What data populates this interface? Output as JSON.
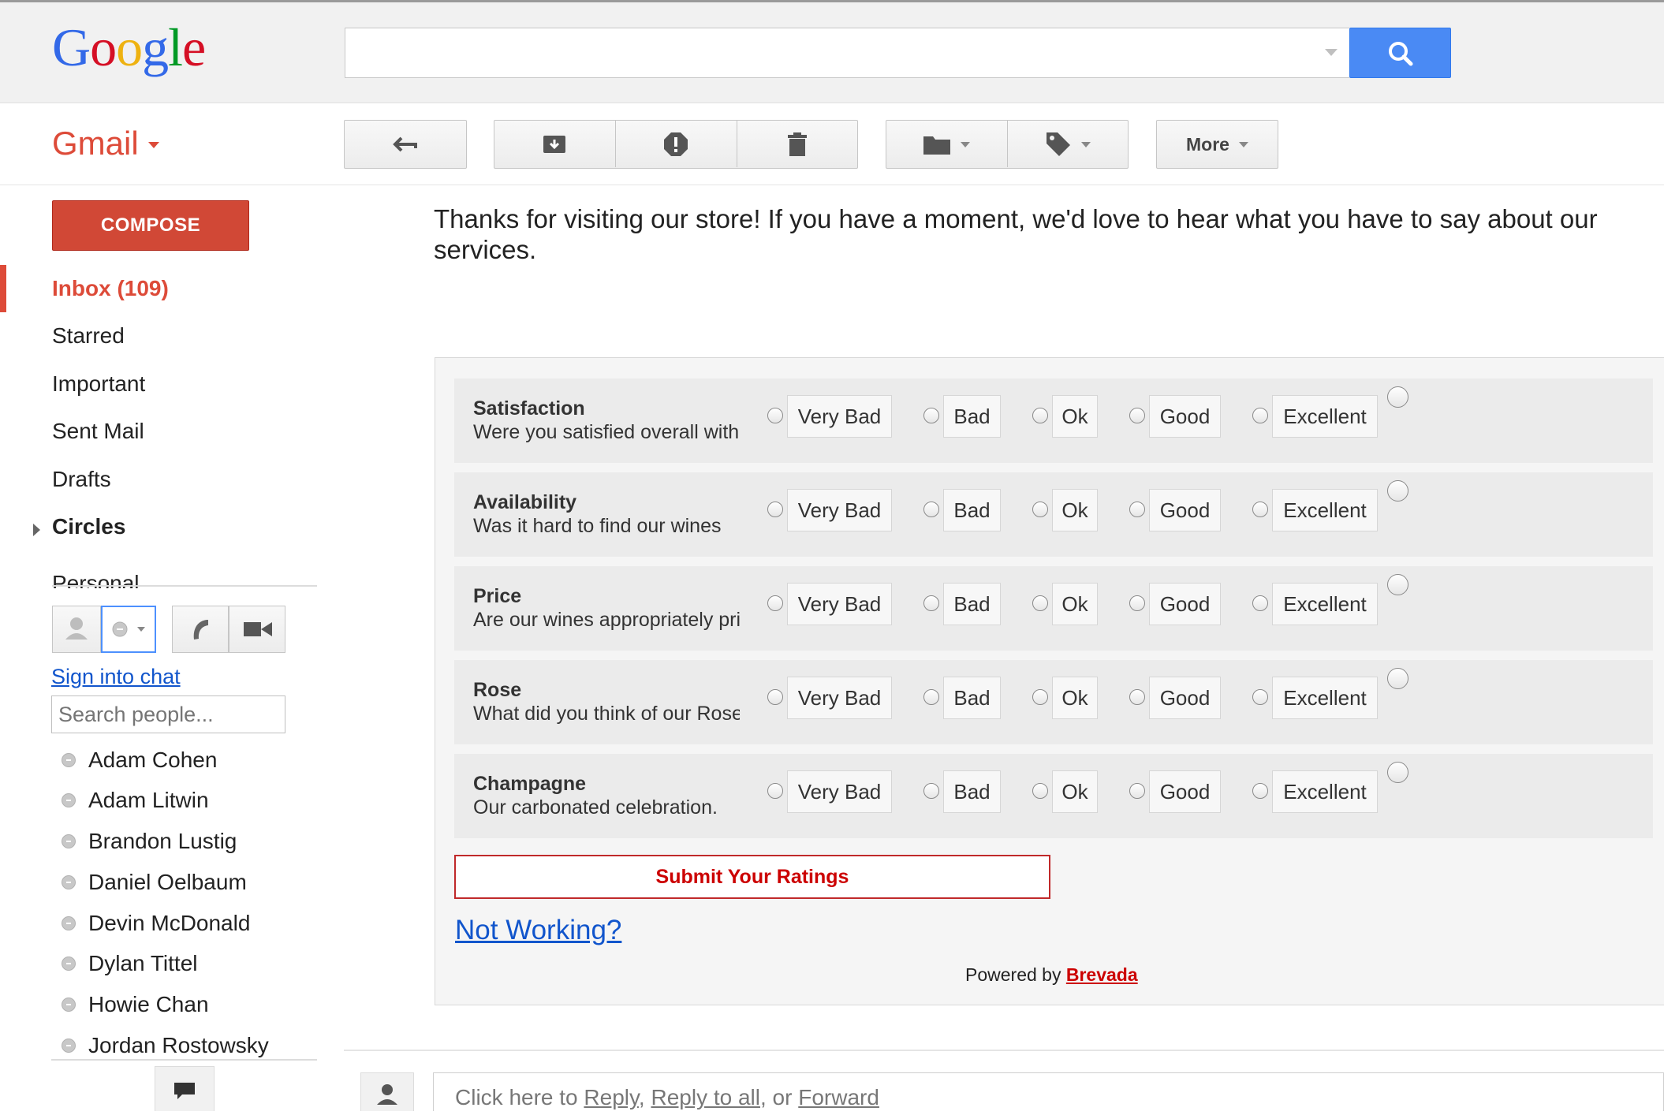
{
  "header": {
    "logo_letters": [
      {
        "ch": "G",
        "color": "#3369e8"
      },
      {
        "ch": "o",
        "color": "#d50f25"
      },
      {
        "ch": "o",
        "color": "#eeb211"
      },
      {
        "ch": "g",
        "color": "#3369e8"
      },
      {
        "ch": "l",
        "color": "#009925"
      },
      {
        "ch": "e",
        "color": "#d50f25"
      }
    ],
    "search_value": "",
    "search_icon": "magnifier-icon"
  },
  "app": {
    "label": "Gmail"
  },
  "toolbar": {
    "back_icon": "back-arrow-icon",
    "archive_icon": "archive-icon",
    "spam_icon": "report-spam-icon",
    "delete_icon": "trash-icon",
    "move_icon": "folder-icon",
    "labels_icon": "label-tag-icon",
    "more_label": "More"
  },
  "sidebar": {
    "compose_label": "COMPOSE",
    "items": [
      {
        "label": "Inbox (109)"
      },
      {
        "label": "Starred"
      },
      {
        "label": "Important"
      },
      {
        "label": "Sent Mail"
      },
      {
        "label": "Drafts"
      },
      {
        "label": "Circles"
      },
      {
        "label": "Personal"
      }
    ]
  },
  "chat": {
    "sign_in_label": "Sign into chat",
    "search_placeholder": "Search people...",
    "contacts": [
      "Adam Cohen",
      "Adam Litwin",
      "Brandon Lustig",
      "Daniel Oelbaum",
      "Devin McDonald",
      "Dylan Tittel",
      "Howie Chan",
      "Jordan Rostowsky"
    ]
  },
  "email": {
    "intro": "Thanks for visiting our store! If you have a moment, we'd love to hear what you have to say about our services.",
    "options": [
      "Very Bad",
      "Bad",
      "Ok",
      "Good",
      "Excellent"
    ],
    "questions": [
      {
        "title": "Satisfaction",
        "subtitle": "Were you satisfied overall with"
      },
      {
        "title": "Availability",
        "subtitle": "Was it hard to find our wines"
      },
      {
        "title": "Price",
        "subtitle": "Are our wines appropriately priced"
      },
      {
        "title": "Rose",
        "subtitle": "What did you think of our Rose"
      },
      {
        "title": "Champagne",
        "subtitle": "Our carbonated celebration."
      }
    ],
    "submit_label": "Submit Your Ratings",
    "not_working_label": "Not Working?",
    "powered_prefix": "Powered by",
    "powered_brand": "Brevada"
  },
  "reply": {
    "prefix": "Click here to",
    "reply_label": "Reply",
    "sep1": ",",
    "reply_all_label": "Reply to all",
    "sep2": ", or",
    "forward_label": "Forward"
  }
}
